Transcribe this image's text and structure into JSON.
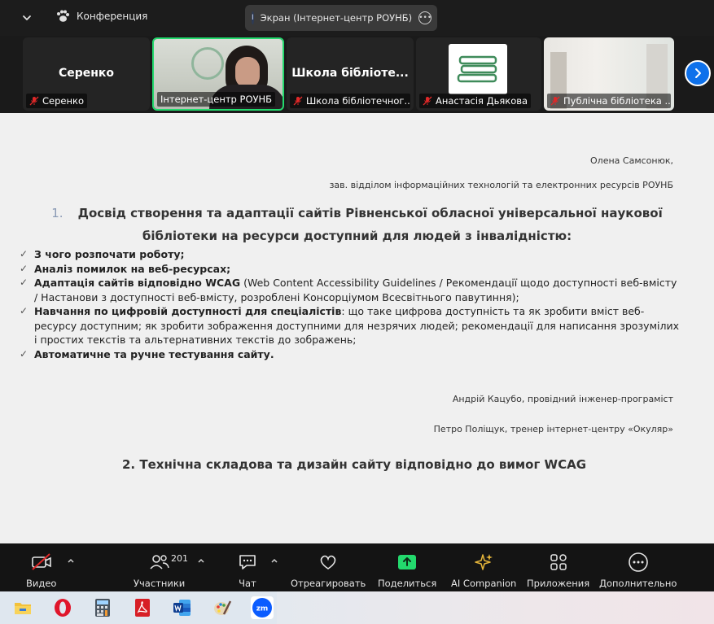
{
  "topbar": {
    "meeting_label": "Конференция",
    "share_badge": "I",
    "share_title": "Экран (Інтернет-центр РОУНБ)"
  },
  "participants": [
    {
      "name": "Серенко",
      "display": "Серенко",
      "muted": true
    },
    {
      "name": "Інтернет-центр РОУНБ",
      "muted": true,
      "active": true
    },
    {
      "name": "Школа бібліотечног...",
      "display": "Школа бібліоте...",
      "muted": true
    },
    {
      "name": "Анастасія Дьякова",
      "muted": true
    },
    {
      "name": "Публічна бібліотека ...",
      "muted": true
    }
  ],
  "document": {
    "author_name": "Олена Самсонюк,",
    "author_title": "зав. відділом інформаційних технологій та електронних ресурсів РОУНБ",
    "section1_number": "1.",
    "section1_title_line1": "Досвід створення та адаптації сайтів Рівненської обласної універсальної наукової",
    "section1_title_line2": "бібліотеки на ресурси доступний для людей з інвалідністю:",
    "items": [
      {
        "bold": "З чого розпочати роботу;",
        "text": ""
      },
      {
        "bold": "Аналіз помилок на веб-ресурсах;",
        "text": ""
      },
      {
        "bold": "Адаптація сайтів відповідно WCAG",
        "text": " (Web Content Accessibility Guidelines / Рекомендації щодо доступності веб-вмісту / Настанови з доступності веб-вмісту, розроблені Консорціумом Всесвітнього павутиння);"
      },
      {
        "bold": "Навчання по цифровій доступності для спеціалістів",
        "text": ": що таке цифрова доступність та як зробити вміст веб-ресурсу доступним; як зробити зображення доступними для незрячих людей; рекомендації для написання зрозумілих і простих текстів та альтернативних текстів до зображень;"
      },
      {
        "bold": "Автоматичне та ручне тестування сайту.",
        "text": ""
      }
    ],
    "speaker1": "Андрій Кацубо, провідний інженер-програміст",
    "speaker2": "Петро Поліщук, тренер інтернет-центру «Окуляр»",
    "section2_title": "2. Технічна складова та дизайн сайту відповідно до вимог WCAG"
  },
  "toolbar": {
    "video": "Видео",
    "participants": "Участники",
    "participants_count": "201",
    "chat": "Чат",
    "react": "Отреагировать",
    "share": "Поделиться",
    "ai": "AI Companion",
    "apps": "Приложения",
    "more": "Дополнительно"
  },
  "colors": {
    "accent_blue": "#0e71eb",
    "share_green": "#23d96d",
    "ai_gold": "#e5b53a",
    "muted_red": "#e02828"
  },
  "taskbar_apps": [
    "file-explorer-icon",
    "opera-icon",
    "calculator-icon",
    "pdf-reader-icon",
    "word-icon",
    "paint-icon",
    "zoom-icon"
  ]
}
